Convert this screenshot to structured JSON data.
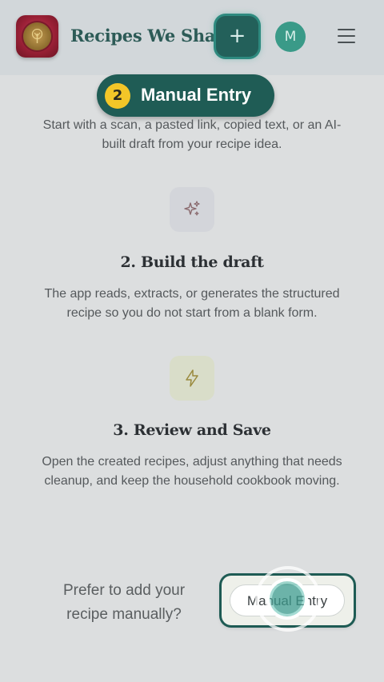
{
  "header": {
    "app_title": "Recipes We Share",
    "add_label": "+",
    "avatar_initial": "M"
  },
  "step_pill": {
    "number": "2",
    "label": "Manual Entry"
  },
  "step1": {
    "text_line1": "Start with a scan, a pasted link, copied text, or an AI-",
    "text_line2": "built draft from your recipe idea."
  },
  "step2": {
    "icon": "sparkles-icon",
    "title": "2. Build the draft",
    "text_line1": "The app reads, extracts, or generates the structured",
    "text_line2": "recipe so you do not start from a blank form."
  },
  "step3": {
    "icon": "lightning-icon",
    "title": "3. Review and Save",
    "text_line1": "Open the created recipes, adjust anything that needs",
    "text_line2": "cleanup, and keep the household cookbook moving."
  },
  "bottom": {
    "prefer_line1": "Prefer to add your",
    "prefer_line2": "recipe manually?",
    "manual_button": "Manual Entry"
  },
  "colors": {
    "brand_teal": "#1f5c55",
    "accent_yellow": "#f3c628",
    "avatar": "#3a9a88"
  }
}
